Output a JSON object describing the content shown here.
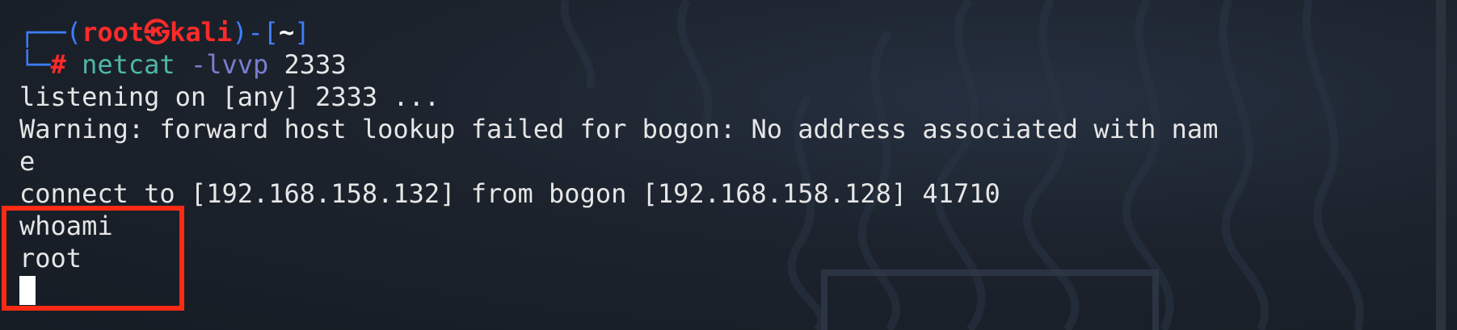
{
  "prompt": {
    "box_top": "┌──(",
    "user": "root",
    "at_symbol": "㉿",
    "host": "kali",
    "close_paren": ")-[",
    "dir": "~",
    "close_bracket": "]",
    "box_bottom": "└─",
    "hash": "#"
  },
  "command": {
    "name": "netcat",
    "flags": "-lvvp",
    "port": "2333"
  },
  "output": {
    "line1": "listening on [any] 2333 ...",
    "line2": "Warning: forward host lookup failed for bogon: No address associated with nam",
    "line3": "e",
    "line4": "connect to [192.168.158.132] from bogon [192.168.158.128] 41710",
    "line5": "whoami",
    "line6": "root"
  },
  "colors": {
    "highlight_box": "#ff2a14",
    "prompt_user": "#ff2a2a",
    "prompt_frame": "#3d7dff",
    "command": "#4fb8a5",
    "flag": "#7a7fd0"
  }
}
